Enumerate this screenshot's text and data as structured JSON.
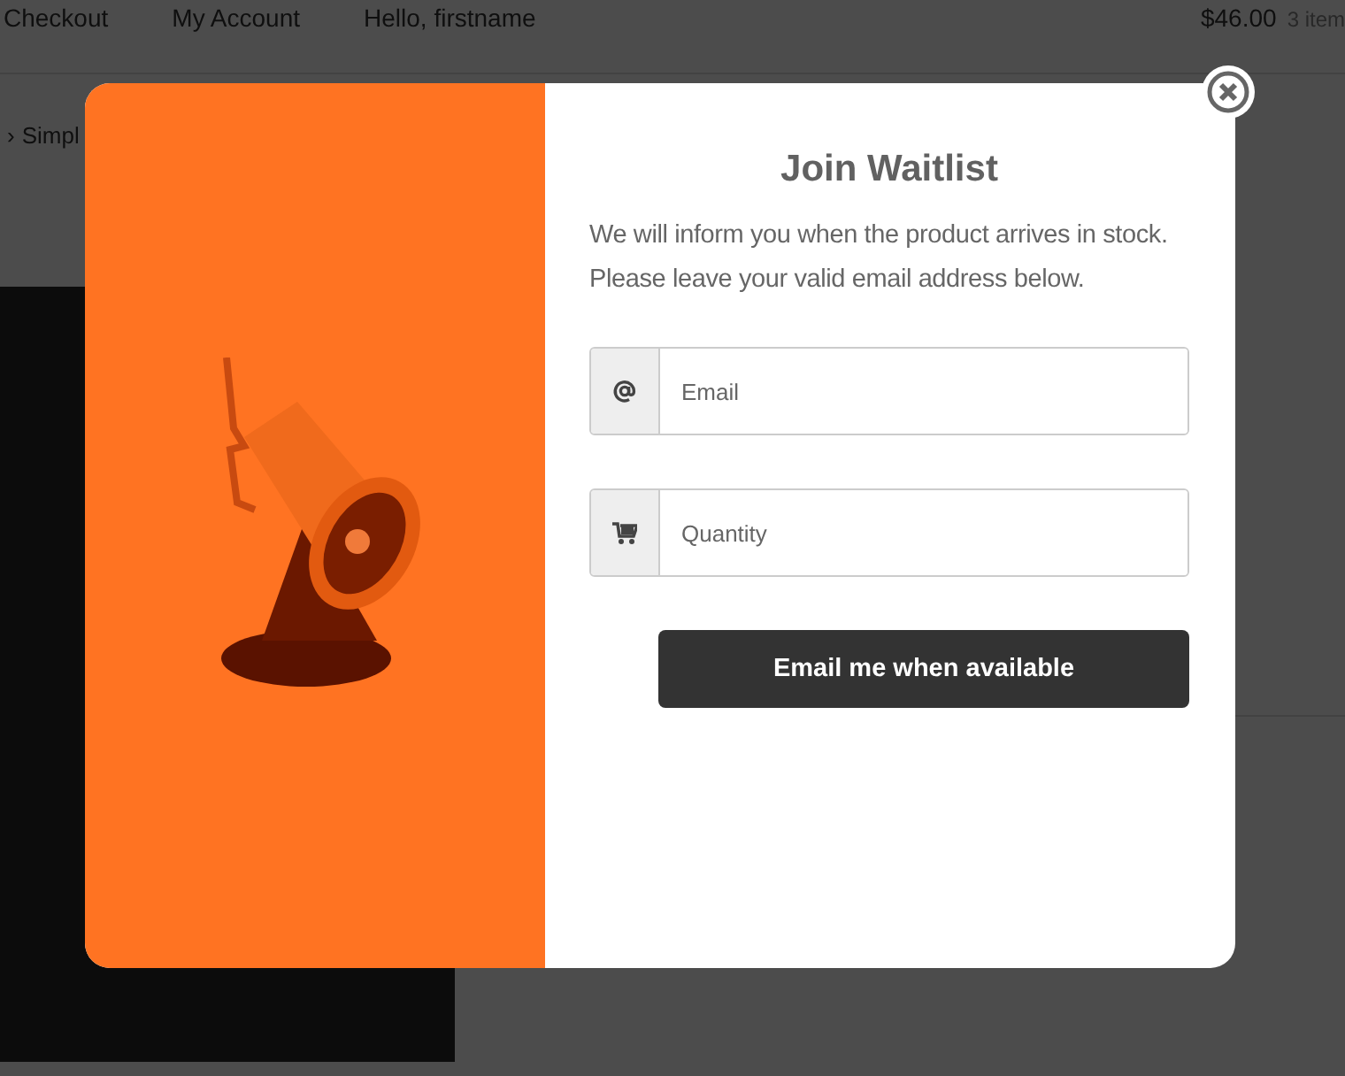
{
  "header": {
    "nav": [
      "Checkout",
      "My Account",
      "Hello, firstname"
    ],
    "cart_total": "$46.00",
    "cart_count": "3 item"
  },
  "breadcrumb": {
    "separator": "›",
    "item": "Simpl"
  },
  "modal": {
    "title": "Join Waitlist",
    "message": "We will inform you when the product arrives in stock. Please leave your valid email address below.",
    "fields": [
      {
        "kind": "email",
        "placeholder": "Email"
      },
      {
        "kind": "quantity",
        "placeholder": "Quantity"
      }
    ],
    "submit": "Email me when available"
  }
}
